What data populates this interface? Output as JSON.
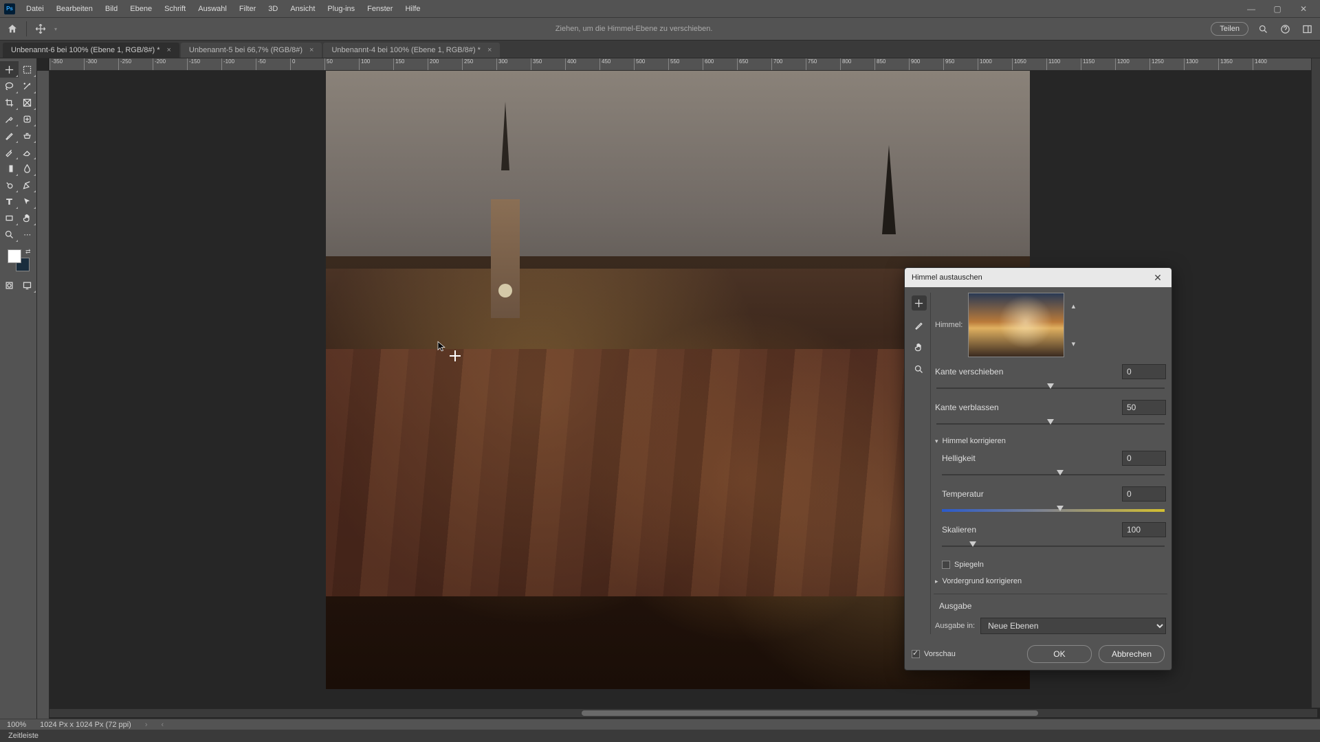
{
  "menu": {
    "items": [
      "Datei",
      "Bearbeiten",
      "Bild",
      "Ebene",
      "Schrift",
      "Auswahl",
      "Filter",
      "3D",
      "Ansicht",
      "Plug-ins",
      "Fenster",
      "Hilfe"
    ]
  },
  "optbar": {
    "hint": "Ziehen, um die Himmel-Ebene zu verschieben.",
    "share": "Teilen"
  },
  "tabs": [
    {
      "label": "Unbenannt-6 bei 100% (Ebene 1, RGB/8#) *",
      "active": true
    },
    {
      "label": "Unbenannt-5 bei 66,7% (RGB/8#)",
      "active": false
    },
    {
      "label": "Unbenannt-4 bei 100% (Ebene 1, RGB/8#) *",
      "active": false
    }
  ],
  "ruler": {
    "labels": [
      "-350",
      "-300",
      "-250",
      "-200",
      "-150",
      "-100",
      "-50",
      "0",
      "50",
      "100",
      "150",
      "200",
      "250",
      "300",
      "350",
      "400",
      "450",
      "500",
      "550",
      "600",
      "650",
      "700",
      "750",
      "800",
      "850",
      "900",
      "950",
      "1000",
      "1050",
      "1100",
      "1150",
      "1200",
      "1250",
      "1300",
      "1350",
      "1400"
    ]
  },
  "status": {
    "zoom": "100%",
    "docinfo": "1024 Px x 1024 Px (72 ppi)"
  },
  "timeline": {
    "label": "Zeitleiste"
  },
  "dialog": {
    "title": "Himmel austauschen",
    "sky_label": "Himmel:",
    "edge_shift": {
      "label": "Kante verschieben",
      "value": "0",
      "pos": 50
    },
    "edge_fade": {
      "label": "Kante verblassen",
      "value": "50",
      "pos": 50
    },
    "sect_sky": {
      "label": "Himmel korrigieren",
      "open": true
    },
    "brightness": {
      "label": "Helligkeit",
      "value": "0",
      "pos": 53
    },
    "temperature": {
      "label": "Temperatur",
      "value": "0",
      "pos": 53
    },
    "scale": {
      "label": "Skalieren",
      "value": "100",
      "pos": 14
    },
    "flip": {
      "label": "Spiegeln",
      "checked": false
    },
    "sect_fg": {
      "label": "Vordergrund korrigieren",
      "open": false
    },
    "output": {
      "heading": "Ausgabe",
      "label": "Ausgabe in:",
      "value": "Neue Ebenen"
    },
    "preview": {
      "label": "Vorschau",
      "checked": true
    },
    "ok": "OK",
    "cancel": "Abbrechen"
  }
}
